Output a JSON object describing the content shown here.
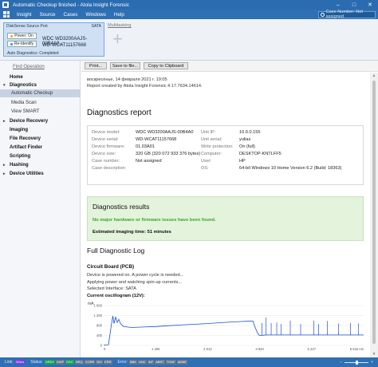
{
  "window": {
    "title": "Automatic Checkup finished - Atola Insight Forensic"
  },
  "menu": {
    "items": [
      "Insight",
      "Source",
      "Cases",
      "Windows",
      "Help"
    ],
    "search_placeholder": "Case Number: Not assigned"
  },
  "device_panel": {
    "port_label": "DiskSense Source Port",
    "interface": "SATA",
    "power_label": "Power: On",
    "reidentify_label": "Re-Identify",
    "model": "WDC WD3200AAJS-00B4A0...",
    "serial": "WD-WCAT11157668",
    "auto_diag": "Auto Diagnostics: Completed",
    "multitasking": "Multitasking"
  },
  "sidebar": {
    "find_operation": "Find Operation",
    "items": [
      {
        "label": "Home",
        "type": "bold",
        "arrow": ""
      },
      {
        "label": "Diagnostics",
        "type": "bold",
        "arrow": "▾"
      },
      {
        "label": "Automatic Checkup",
        "type": "sub",
        "active": true
      },
      {
        "label": "Media Scan",
        "type": "sub"
      },
      {
        "label": "View SMART",
        "type": "sub"
      },
      {
        "label": "Device Recovery",
        "type": "bold",
        "arrow": "▸"
      },
      {
        "label": "Imaging",
        "type": "bold",
        "arrow": ""
      },
      {
        "label": "File Recovery",
        "type": "bold",
        "arrow": ""
      },
      {
        "label": "Artifact Finder",
        "type": "bold",
        "arrow": ""
      },
      {
        "label": "Scripting",
        "type": "bold",
        "arrow": ""
      },
      {
        "label": "Hashing",
        "type": "bold",
        "arrow": "▸"
      },
      {
        "label": "Device Utilities",
        "type": "bold",
        "arrow": "▸"
      }
    ]
  },
  "toolbar": {
    "print": "Print...",
    "save": "Save to file...",
    "copy": "Copy to Clipboard"
  },
  "report": {
    "date": "воскресенье, 14 февраля 2021 г. 19:05",
    "created_by": "Report created by Atola Insight Forensic 4.17.7634.14614.",
    "title": "Diagnostics report",
    "left_keys": [
      "Device model:",
      "Device serial:",
      "Device firmware:",
      "Device size:",
      "Case number:",
      "Case description:"
    ],
    "left_vals": [
      "WDC WD3200AAJS-00B4A0",
      "WD-WCAT11157668",
      "01.03A01",
      "320 GB (320 072 933 376 bytes)",
      "Not assigned",
      ""
    ],
    "right_keys": [
      "Unit IP:",
      "Unit serial:",
      "Write protection:",
      "Computer:",
      "User:",
      "OS:"
    ],
    "right_vals": [
      "10.0.0.155",
      "yulias",
      "On (full)",
      "DESKTOP-KNTLFF5",
      "HP",
      "64-bit Windows 10 Home Version 6.2 (Build: 18363)"
    ],
    "results_title": "Diagnostics results",
    "results_ok": "No major hardware or firmware issues have been found.",
    "results_time": "Estimated imaging time: 51 minutes",
    "log_title": "Full Diagnostic Log",
    "cb_title": "Circuit Board (PCB)",
    "log_lines": [
      "Device is powered on. A power cycle is needed...",
      "Applying power and watching spin-up currents...",
      "Selected Interface: SATA"
    ],
    "osc_title": "Current oscillogram (12V):"
  },
  "chart_data": {
    "type": "line",
    "title": "Current oscillogram (12V):",
    "ylabel": "mA",
    "xlabel": "",
    "x_ticks": [
      "0",
      "1 306",
      "2 613",
      "3 920",
      "5 227",
      "6 534 ms"
    ],
    "y_ticks": [
      "1 600",
      "1 200",
      "800",
      "400",
      "0"
    ],
    "xlim": [
      0,
      6534
    ],
    "ylim": [
      0,
      1600
    ],
    "series": [
      {
        "color": "#1f4fd1",
        "points": [
          [
            0,
            20
          ],
          [
            120,
            30
          ],
          [
            200,
            900
          ],
          [
            230,
            1180
          ],
          [
            260,
            880
          ],
          [
            300,
            1150
          ],
          [
            340,
            920
          ],
          [
            380,
            1050
          ],
          [
            420,
            880
          ],
          [
            500,
            760
          ],
          [
            700,
            720
          ],
          [
            1000,
            740
          ],
          [
            1306,
            760
          ],
          [
            1600,
            790
          ],
          [
            2000,
            830
          ],
          [
            2400,
            860
          ],
          [
            2613,
            880
          ],
          [
            2900,
            910
          ],
          [
            3200,
            940
          ],
          [
            3450,
            960
          ],
          [
            3600,
            970
          ],
          [
            3750,
            980
          ],
          [
            3800,
            760
          ],
          [
            3850,
            560
          ],
          [
            3900,
            420
          ],
          [
            3920,
            400
          ],
          [
            4000,
            410
          ],
          [
            4100,
            420
          ],
          [
            4300,
            420
          ],
          [
            5227,
            420
          ],
          [
            6000,
            420
          ],
          [
            6534,
            420
          ]
        ],
        "spikes": [
          [
            3980,
            900
          ],
          [
            4080,
            1120
          ],
          [
            4210,
            900
          ],
          [
            4350,
            920
          ],
          [
            4460,
            860
          ],
          [
            4690,
            1000
          ],
          [
            4950,
            860
          ],
          [
            5280,
            1000
          ],
          [
            5400,
            860
          ],
          [
            5620,
            980
          ],
          [
            5900,
            880
          ],
          [
            6200,
            900
          ],
          [
            6400,
            880
          ]
        ]
      }
    ]
  },
  "status": {
    "link_label": "Link:",
    "status_label": "Status:",
    "error_label": "Error:",
    "badges": [
      "DRDY",
      "DWF",
      "DSC",
      "DRQ",
      "CORR",
      "IDX",
      "ERR"
    ],
    "error_badges": [
      "BBK",
      "UNC",
      "INF",
      "ABRT",
      "TONF",
      "AMNF"
    ],
    "link_value": "3Gb/s",
    "zoom": "Zoom"
  }
}
